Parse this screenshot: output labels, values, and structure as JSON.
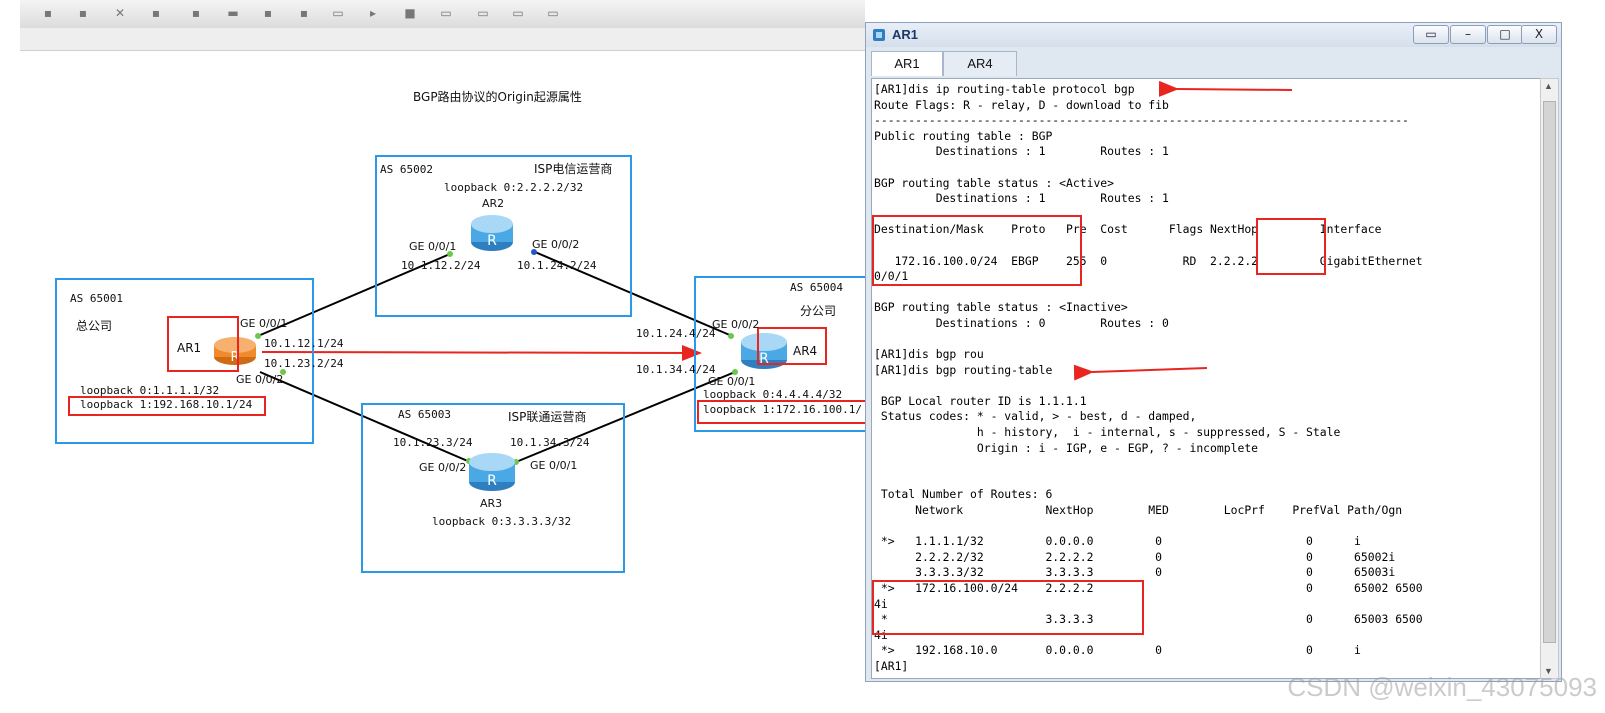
{
  "diagram": {
    "title": "BGP路由协议的Origin起源属性",
    "as_blocks": [
      {
        "as": "AS 65001",
        "name": "总公司",
        "loopbacks": [
          "loopback 0:1.1.1.1/32",
          "loopback 1:192.168.10.1/24"
        ]
      },
      {
        "as": "AS 65002",
        "name": "ISP电信运营商",
        "loopbacks": [
          "loopback 0:2.2.2.2/32"
        ]
      },
      {
        "as": "AS 65003",
        "name": "ISP联通运营商",
        "loopbacks": [
          "loopback 0:3.3.3.3/32"
        ]
      },
      {
        "as": "AS 65004",
        "name": "分公司",
        "loopbacks": [
          "loopback 0:4.4.4.4/32",
          "loopback 1:172.16.100.1/"
        ]
      }
    ],
    "routers": {
      "ar1": "AR1",
      "ar2": "AR2",
      "ar3": "AR3",
      "ar4": "AR4"
    },
    "interfaces": {
      "ar1_g001": "GE 0/0/1",
      "ar1_g002": "GE 0/0/2",
      "ar2_g001": "GE 0/0/1",
      "ar2_g002": "GE 0/0/2",
      "ar3_g002": "GE 0/0/2",
      "ar3_g001": "GE 0/0/1",
      "ar4_g002": "GE 0/0/2",
      "ar4_g001": "GE 0/0/1"
    },
    "ips": {
      "ar1_a": "10.1.12.1/24",
      "ar1_b": "10.1.23.2/24",
      "ar2_a": "10.1.12.2/24",
      "ar2_b": "10.1.24.2/24",
      "ar3_a": "10.1.23.3/24",
      "ar3_b": "10.1.34.3/24",
      "ar4_a": "10.1.24.4/24",
      "ar4_b": "10.1.34.4/24"
    },
    "colors": {
      "as_border": "#2a9ae8",
      "highlight": "#e8261f",
      "router_blue": "#4aa9e4",
      "router_orange": "#f08a2c"
    }
  },
  "window": {
    "title": "AR1",
    "buttons": {
      "restore": "▭",
      "minimize": "–",
      "maximize": "□",
      "close": "X"
    },
    "tabs": [
      "AR1",
      "AR4"
    ],
    "active_tab": "AR1",
    "terminal_lines": [
      "[AR1]dis ip routing-table protocol bgp",
      "Route Flags: R - relay, D - download to fib",
      "------------------------------------------------------------------------------",
      "Public routing table : BGP",
      "         Destinations : 1        Routes : 1",
      "",
      "BGP routing table status : <Active>",
      "         Destinations : 1        Routes : 1",
      "",
      "Destination/Mask    Proto   Pre  Cost      Flags NextHop         Interface",
      "",
      "   172.16.100.0/24  EBGP    255  0           RD  2.2.2.2         GigabitEthernet",
      "0/0/1",
      "",
      "BGP routing table status : <Inactive>",
      "         Destinations : 0        Routes : 0",
      "",
      "[AR1]dis bgp rou",
      "[AR1]dis bgp routing-table",
      "",
      " BGP Local router ID is 1.1.1.1",
      " Status codes: * - valid, > - best, d - damped,",
      "               h - history,  i - internal, s - suppressed, S - Stale",
      "               Origin : i - IGP, e - EGP, ? - incomplete",
      "",
      "",
      " Total Number of Routes: 6",
      "      Network            NextHop        MED        LocPrf    PrefVal Path/Ogn",
      "",
      " *>   1.1.1.1/32         0.0.0.0         0                     0      i",
      "      2.2.2.2/32         2.2.2.2         0                     0      65002i",
      "      3.3.3.3/32         3.3.3.3         0                     0      65003i",
      " *>   172.16.100.0/24    2.2.2.2                               0      65002 6500",
      "4i",
      " *                       3.3.3.3                               0      65003 6500",
      "4i",
      " *>   192.168.10.0       0.0.0.0         0                     0      i",
      "[AR1]"
    ]
  },
  "watermark": "CSDN @weixin_43075093"
}
